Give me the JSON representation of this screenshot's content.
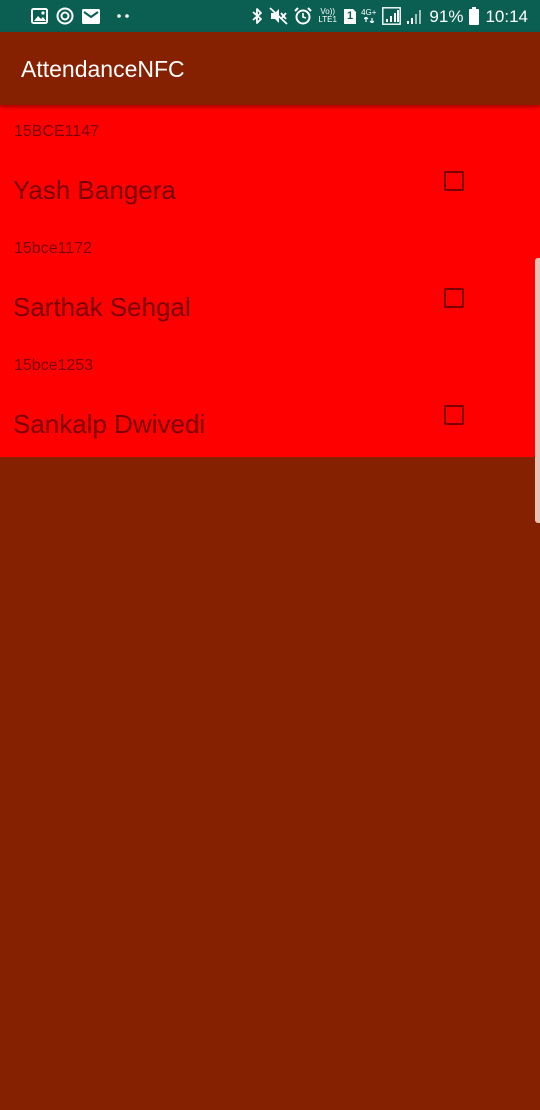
{
  "status_bar": {
    "background": "#0b5e52",
    "left_icons": [
      "image-icon",
      "circle-target-icon",
      "mail-icon",
      "more-dots-icon"
    ],
    "right_icons": [
      "bluetooth-icon",
      "mute-icon",
      "alarm-icon",
      "volte-icon",
      "sim-icon",
      "network-4g-icon",
      "signal-icon",
      "signal-secondary-icon",
      "battery-icon"
    ],
    "volte_label_top": "Vo))",
    "volte_label_bottom": "LTE1",
    "sim_label": "1",
    "network_label": "4G+",
    "battery": "91%",
    "time": "10:14"
  },
  "app_bar": {
    "title": "AttendanceNFC",
    "background": "#852000"
  },
  "students": [
    {
      "roll": "15BCE1147",
      "name": "Yash Bangera",
      "checked": false
    },
    {
      "roll": "15bce1172",
      "name": "Sarthak Sehgal",
      "checked": false
    },
    {
      "roll": "15bce1253",
      "name": "Sankalp Dwivedi",
      "checked": false
    }
  ],
  "colors": {
    "list_background": "#ff0000",
    "text": "#7a0000",
    "page_background": "#852000"
  }
}
